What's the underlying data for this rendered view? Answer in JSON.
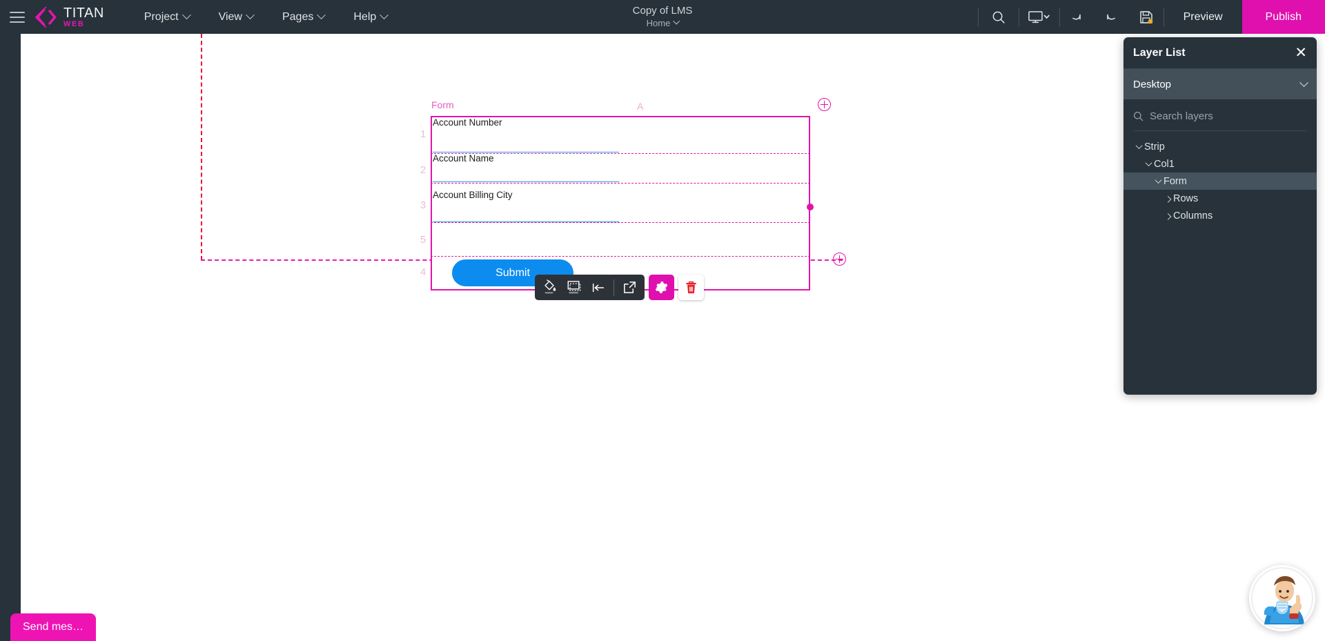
{
  "topbar": {
    "hamburger_icon": "hamburger-icon",
    "brand": {
      "name": "TITAN",
      "sub": "WEB"
    },
    "menus": [
      {
        "label": "Project",
        "icon": "chevron-down-icon"
      },
      {
        "label": "View",
        "icon": "chevron-down-icon"
      },
      {
        "label": "Pages",
        "icon": "chevron-down-icon"
      },
      {
        "label": "Help",
        "icon": "chevron-down-icon"
      }
    ],
    "document": {
      "title": "Copy of LMS",
      "page": "Home"
    },
    "actions": {
      "search_icon": "search-icon",
      "device_icon": "desktop-icon",
      "undo_icon": "undo-icon",
      "redo_icon": "redo-icon",
      "save_icon": "save-icon",
      "preview_label": "Preview",
      "publish_label": "Publish"
    },
    "colors": {
      "bar_bg": "#27323a",
      "accent": "#e010ae"
    }
  },
  "left_rail": {
    "add_button_icon": "plus-icon",
    "settings_button_icon": "gear-icon"
  },
  "canvas": {
    "form_title": "Form",
    "column_label": "A",
    "row_numbers": [
      "1",
      "2",
      "3",
      "5",
      "4"
    ],
    "fields": [
      {
        "label": "Account Number"
      },
      {
        "label": "Account Name"
      },
      {
        "label": "Account Billing City"
      }
    ],
    "submit_label": "Submit",
    "add_top_icon": "plus-circle-icon",
    "add_bottom_icon": "plus-circle-icon",
    "resize_handle_icon": "resize-handle-dot",
    "colors": {
      "selection": "#e312a8",
      "strip_outline": "#f10a3c",
      "input_underline": "#2e9bdf",
      "submit_bg": "#0d8cf0"
    }
  },
  "context_toolbar": {
    "buttons": [
      {
        "name": "fill-color-button",
        "icon": "paint-bucket-icon"
      },
      {
        "name": "border-shadow-button",
        "icon": "square-dashed-icon"
      },
      {
        "name": "align-button",
        "icon": "align-left-icon"
      },
      {
        "name": "open-external-button",
        "icon": "external-link-icon"
      },
      {
        "name": "settings-button",
        "icon": "gear-icon"
      },
      {
        "name": "delete-button",
        "icon": "trash-icon"
      }
    ]
  },
  "layer_list": {
    "title": "Layer List",
    "close_icon": "close-icon",
    "device": {
      "label": "Desktop",
      "icon": "chevron-down-icon"
    },
    "search": {
      "placeholder": "Search layers",
      "value": "",
      "icon": "search-icon"
    },
    "tree": [
      {
        "label": "Strip",
        "depth": 0,
        "state": "expanded",
        "selected": false
      },
      {
        "label": "Col1",
        "depth": 1,
        "state": "expanded",
        "selected": false
      },
      {
        "label": "Form",
        "depth": 2,
        "state": "expanded",
        "selected": true
      },
      {
        "label": "Rows",
        "depth": 3,
        "state": "collapsed",
        "selected": false
      },
      {
        "label": "Columns",
        "depth": 3,
        "state": "collapsed",
        "selected": false
      }
    ]
  },
  "chat_widget": {
    "tab_label": "Send mes…",
    "mascot_icon": "support-mascot-avatar"
  }
}
